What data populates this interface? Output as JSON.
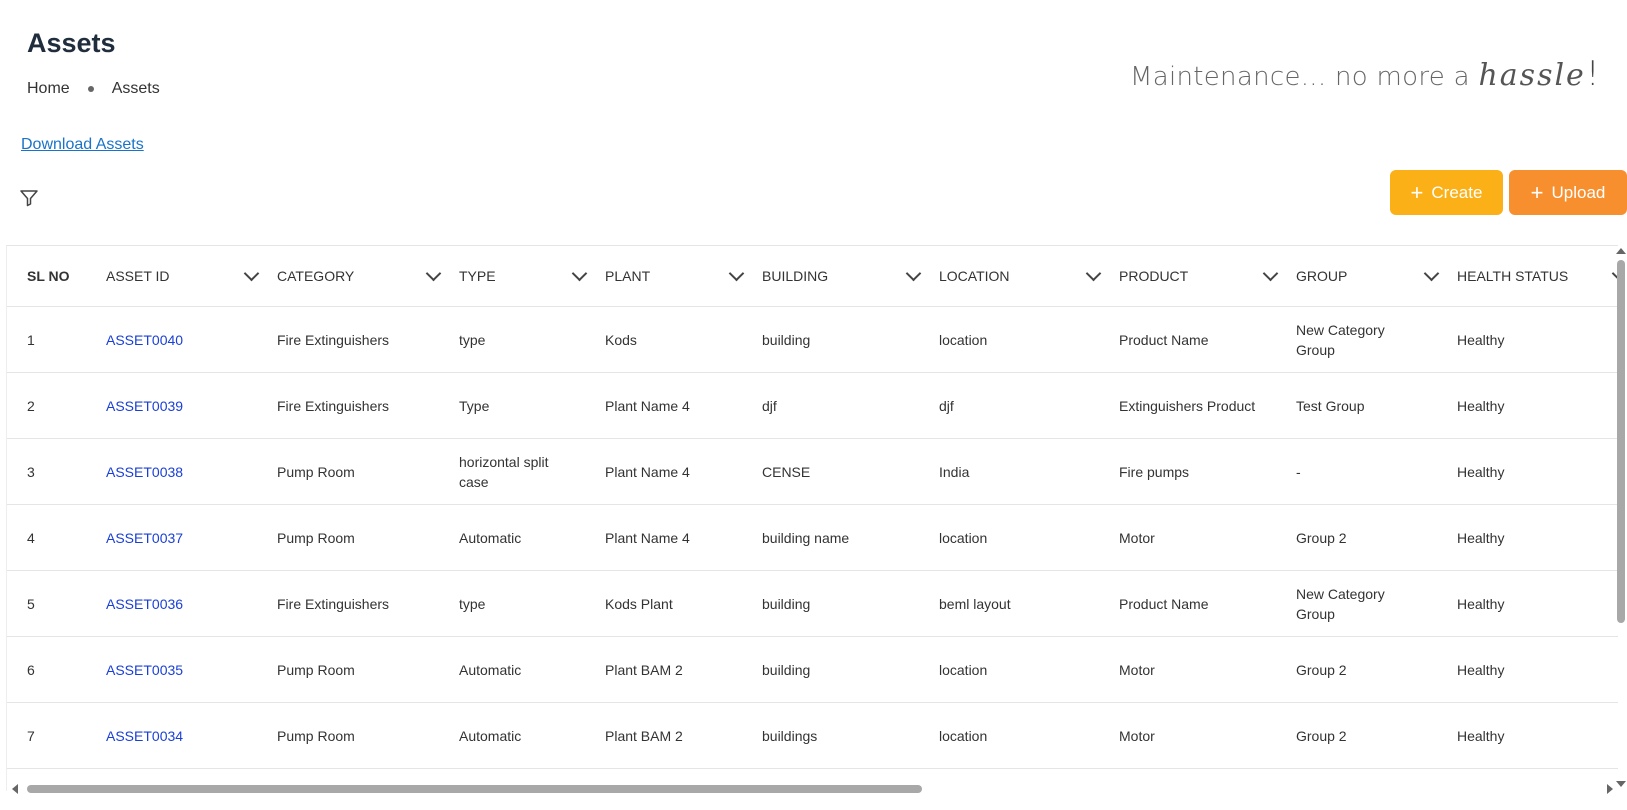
{
  "page": {
    "title": "Assets",
    "breadcrumb": {
      "home": "Home",
      "current": "Assets"
    },
    "tagline": {
      "prefix": "Maintenance... no more a ",
      "script_word": "hassle",
      "suffix": "!"
    }
  },
  "actions": {
    "download_label": "Download Assets",
    "create_label": "Create",
    "upload_label": "Upload"
  },
  "colors": {
    "create": "#fbb017",
    "upload": "#f88f2f",
    "link": "#1a3fd6"
  },
  "table": {
    "columns": [
      "SL NO",
      "ASSET ID",
      "CATEGORY",
      "TYPE",
      "PLANT",
      "BUILDING",
      "LOCATION",
      "PRODUCT",
      "GROUP",
      "HEALTH STATUS"
    ],
    "rows": [
      [
        "1",
        "ASSET0040",
        "Fire Extinguishers",
        "type",
        "Kods",
        "building",
        "location",
        "Product Name",
        "New Category Group",
        "Healthy"
      ],
      [
        "2",
        "ASSET0039",
        "Fire Extinguishers",
        "Type",
        "Plant Name 4",
        "djf",
        "djf",
        "Extinguishers Product",
        "Test Group",
        "Healthy"
      ],
      [
        "3",
        "ASSET0038",
        "Pump Room",
        "horizontal split case",
        "Plant Name 4",
        "CENSE",
        "India",
        "Fire pumps",
        "-",
        "Healthy"
      ],
      [
        "4",
        "ASSET0037",
        "Pump Room",
        "Automatic",
        "Plant Name 4",
        "building name",
        "location",
        "Motor",
        "Group 2",
        "Healthy"
      ],
      [
        "5",
        "ASSET0036",
        "Fire Extinguishers",
        "type",
        "Kods Plant",
        "building",
        "beml layout",
        "Product Name",
        "New Category Group",
        "Healthy"
      ],
      [
        "6",
        "ASSET0035",
        "Pump Room",
        "Automatic",
        "Plant BAM 2",
        "building",
        "location",
        "Motor",
        "Group 2",
        "Healthy"
      ],
      [
        "7",
        "ASSET0034",
        "Pump Room",
        "Automatic",
        "Plant BAM 2",
        "buildings",
        "location",
        "Motor",
        "Group 2",
        "Healthy"
      ]
    ]
  }
}
